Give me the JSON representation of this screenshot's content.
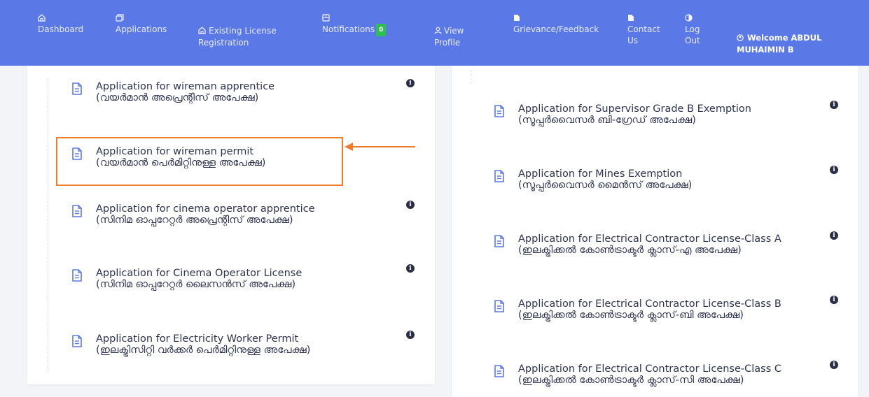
{
  "nav": {
    "dashboard": "Dashboard",
    "applications": "Applications",
    "existing_license": "Existing License\nRegistration",
    "notifications": "Notifications",
    "notifications_count": "0",
    "view_profile": "View\nProfile",
    "grievance": "Grievance/Feedback",
    "contact": "Contact\nUs",
    "logout": "Log\nOut",
    "welcome": "Welcome ABDUL\nMUHAIMIN B"
  },
  "left_items": [
    {
      "title": "Application for wireman apprentice",
      "sub": "(വയർമാൻ അപ്രെന്റിസ് അപേക്ഷ)"
    },
    {
      "title": "Application for wireman permit",
      "sub": "(വയർമാൻ പെർമിറ്റിനുള്ള അപേക്ഷ)"
    },
    {
      "title": "Application for cinema operator apprentice",
      "sub": "(സിനിമ ഓപ്പറേറ്റർ അപ്രെന്റിസ് അപേക്ഷ)"
    },
    {
      "title": "Application for Cinema Operator License",
      "sub": "(സിനിമ ഓപ്പറേറ്റർ ലൈസൻസ് അപേക്ഷ)"
    },
    {
      "title": "Application for Electricity Worker Permit",
      "sub": "(ഇലക്ട്രിസിറ്റി വർക്കർ പെർമിറ്റിനുള്ള അപേക്ഷ)"
    }
  ],
  "right_items": [
    {
      "title": "Application for Supervisor Grade B Exemption",
      "sub": "(സൂപ്പർവൈസർ ബി-ഗ്രേഡ് അപേക്ഷ)"
    },
    {
      "title": "Application for Mines Exemption",
      "sub": "(സൂപ്പർവൈസർ മൈൻസ് അപേക്ഷ)"
    },
    {
      "title": "Application for Electrical Contractor License-Class A",
      "sub": "(ഇലക്ട്രിക്കൽ കോൺട്രാക്ടർ ക്ലാസ്-എ അപേക്ഷ)"
    },
    {
      "title": "Application for Electrical Contractor License-Class B",
      "sub": "(ഇലക്ട്രിക്കൽ കോൺട്രാക്ടർ ക്ലാസ്-ബി അപേക്ഷ)"
    },
    {
      "title": "Application for Electrical Contractor License-Class C",
      "sub": "(ഇലക്ട്രിക്കൽ കോൺട്രാക്ടർ ക്ലാസ്-സി അപേക്ഷ)"
    }
  ],
  "info_glyph": "i",
  "colors": {
    "navbar": "#5b79e6",
    "highlight": "#ef7d2c",
    "badge": "#2ec04e",
    "doc_icon": "#5b79e6"
  }
}
